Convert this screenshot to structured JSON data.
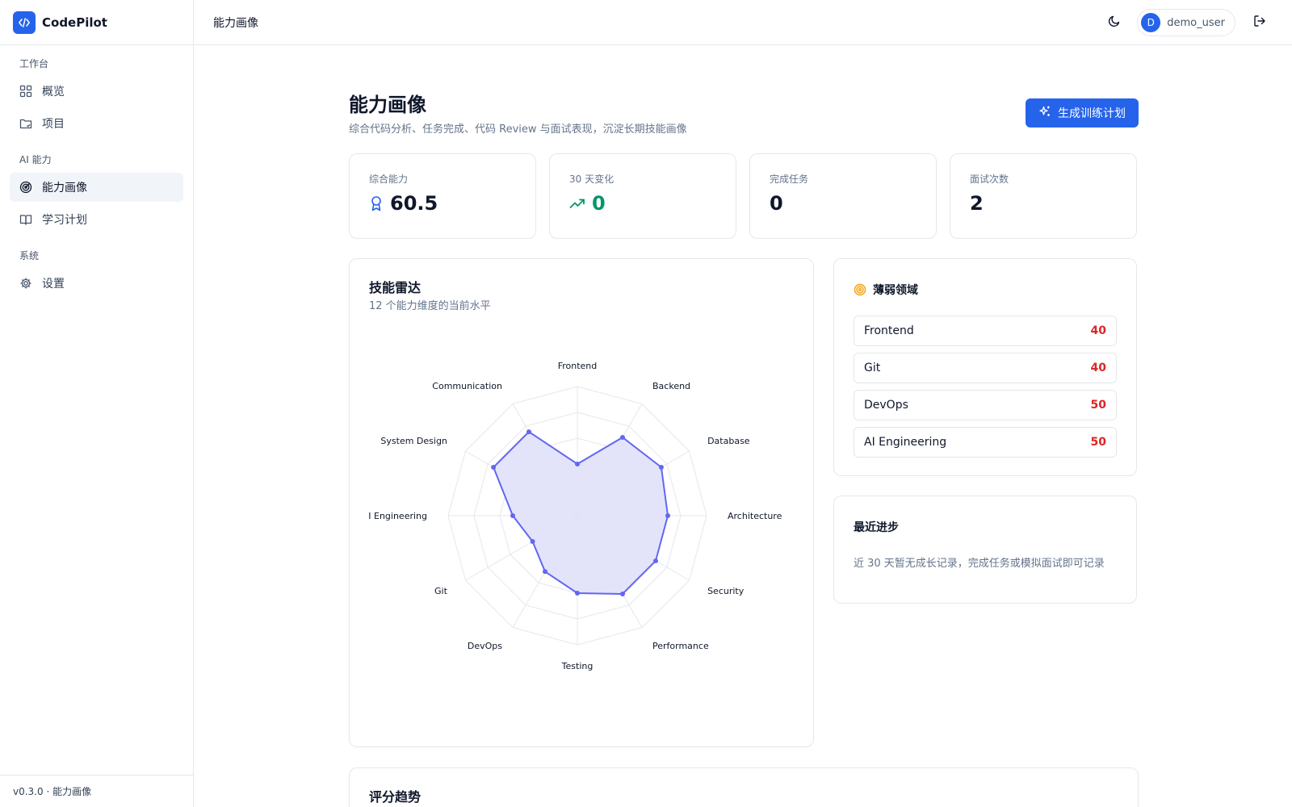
{
  "app": {
    "name": "CodePilot",
    "version_footer": "v0.3.0 · 能力画像"
  },
  "sidebar": {
    "sections": [
      {
        "title": "工作台",
        "items": [
          {
            "label": "概览",
            "icon": "grid-icon"
          },
          {
            "label": "项目",
            "icon": "folder-icon"
          }
        ]
      },
      {
        "title": "AI 能力",
        "items": [
          {
            "label": "能力画像",
            "icon": "radar-icon",
            "active": true
          },
          {
            "label": "学习计划",
            "icon": "book-icon"
          }
        ]
      },
      {
        "title": "系统",
        "items": [
          {
            "label": "设置",
            "icon": "gear-icon"
          }
        ]
      }
    ]
  },
  "header": {
    "title": "能力画像",
    "user": {
      "initial": "D",
      "name": "demo_user"
    }
  },
  "page": {
    "title": "能力画像",
    "subtitle": "综合代码分析、任务完成、代码 Review 与面试表现，沉淀长期技能画像",
    "action_label": "生成训练计划"
  },
  "stats": [
    {
      "label": "综合能力",
      "value": "60.5",
      "icon": "award-icon"
    },
    {
      "label": "30 天变化",
      "value": "0",
      "icon": "trending-up-icon",
      "accent": "#059669"
    },
    {
      "label": "完成任务",
      "value": "0"
    },
    {
      "label": "面试次数",
      "value": "2"
    }
  ],
  "radar": {
    "title": "技能雷达",
    "subtitle": "12 个能力维度的当前水平"
  },
  "chart_data": {
    "type": "radar",
    "categories": [
      "Frontend",
      "Backend",
      "Database",
      "Architecture",
      "Security",
      "Performance",
      "Testing",
      "DevOps",
      "Git",
      "AI Engineering",
      "System Design",
      "Communication"
    ],
    "values": [
      40,
      70,
      75,
      70,
      70,
      70,
      60,
      50,
      40,
      50,
      75,
      75
    ],
    "max": 100,
    "grid_levels": 5,
    "colors": {
      "stroke": "#6366f1",
      "fill": "#e0e1fa",
      "grid": "#e5e7eb"
    }
  },
  "weak": {
    "title": "薄弱领域",
    "items": [
      {
        "name": "Frontend",
        "score": "40"
      },
      {
        "name": "Git",
        "score": "40"
      },
      {
        "name": "DevOps",
        "score": "50"
      },
      {
        "name": "AI Engineering",
        "score": "50"
      }
    ]
  },
  "progress": {
    "title": "最近进步",
    "empty_text": "近 30 天暂无成长记录，完成任务或模拟面试即可记录"
  },
  "trend": {
    "title": "评分趋势"
  }
}
